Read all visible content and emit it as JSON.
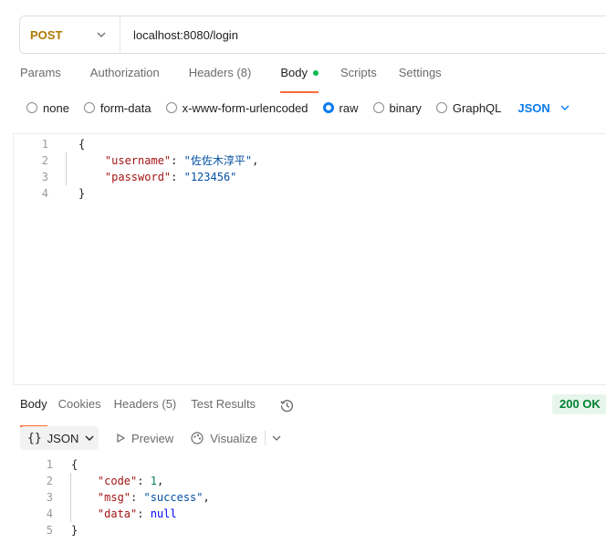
{
  "request": {
    "method": "POST",
    "url": "localhost:8080/login"
  },
  "request_tabs": [
    {
      "label": "Params"
    },
    {
      "label": "Authorization"
    },
    {
      "label": "Headers (8)"
    },
    {
      "label": "Body"
    },
    {
      "label": "Scripts"
    },
    {
      "label": "Settings"
    }
  ],
  "body_types": {
    "none": "none",
    "form_data": "form-data",
    "urlencoded": "x-www-form-urlencoded",
    "raw": "raw",
    "binary": "binary",
    "graphql": "GraphQL",
    "selected": "raw",
    "format": "JSON"
  },
  "request_body": {
    "line_numbers": [
      "1",
      "2",
      "3",
      "4"
    ],
    "open": "{",
    "close": "}",
    "username_key": "\"username\"",
    "username_value": "\"佐佐木淳平\"",
    "password_key": "\"password\"",
    "password_value": "\"123456\""
  },
  "response_tabs": [
    {
      "label": "Body"
    },
    {
      "label": "Cookies"
    },
    {
      "label": "Headers (5)"
    },
    {
      "label": "Test Results"
    }
  ],
  "response": {
    "status": "200 OK",
    "view_format": "JSON",
    "view_format_icon": "{}",
    "preview_label": "Preview",
    "visualize_label": "Visualize",
    "line_numbers": [
      "1",
      "2",
      "3",
      "4",
      "5"
    ],
    "open": "{",
    "close": "}",
    "code_key": "\"code\"",
    "code_value": "1",
    "msg_key": "\"msg\"",
    "msg_value": "\"success\"",
    "data_key": "\"data\"",
    "data_value": "null"
  },
  "colors": {
    "method": "#ad7a03",
    "accent": "#ff6c37",
    "link": "#097bed",
    "status_ok": "#007f31"
  },
  "icons": {
    "method_dropdown": "chevron-down-icon",
    "format_dropdown": "chevron-down-icon",
    "history": "history-icon",
    "preview": "play-icon",
    "visualize": "visualize-icon",
    "more": "chevron-down-icon"
  }
}
